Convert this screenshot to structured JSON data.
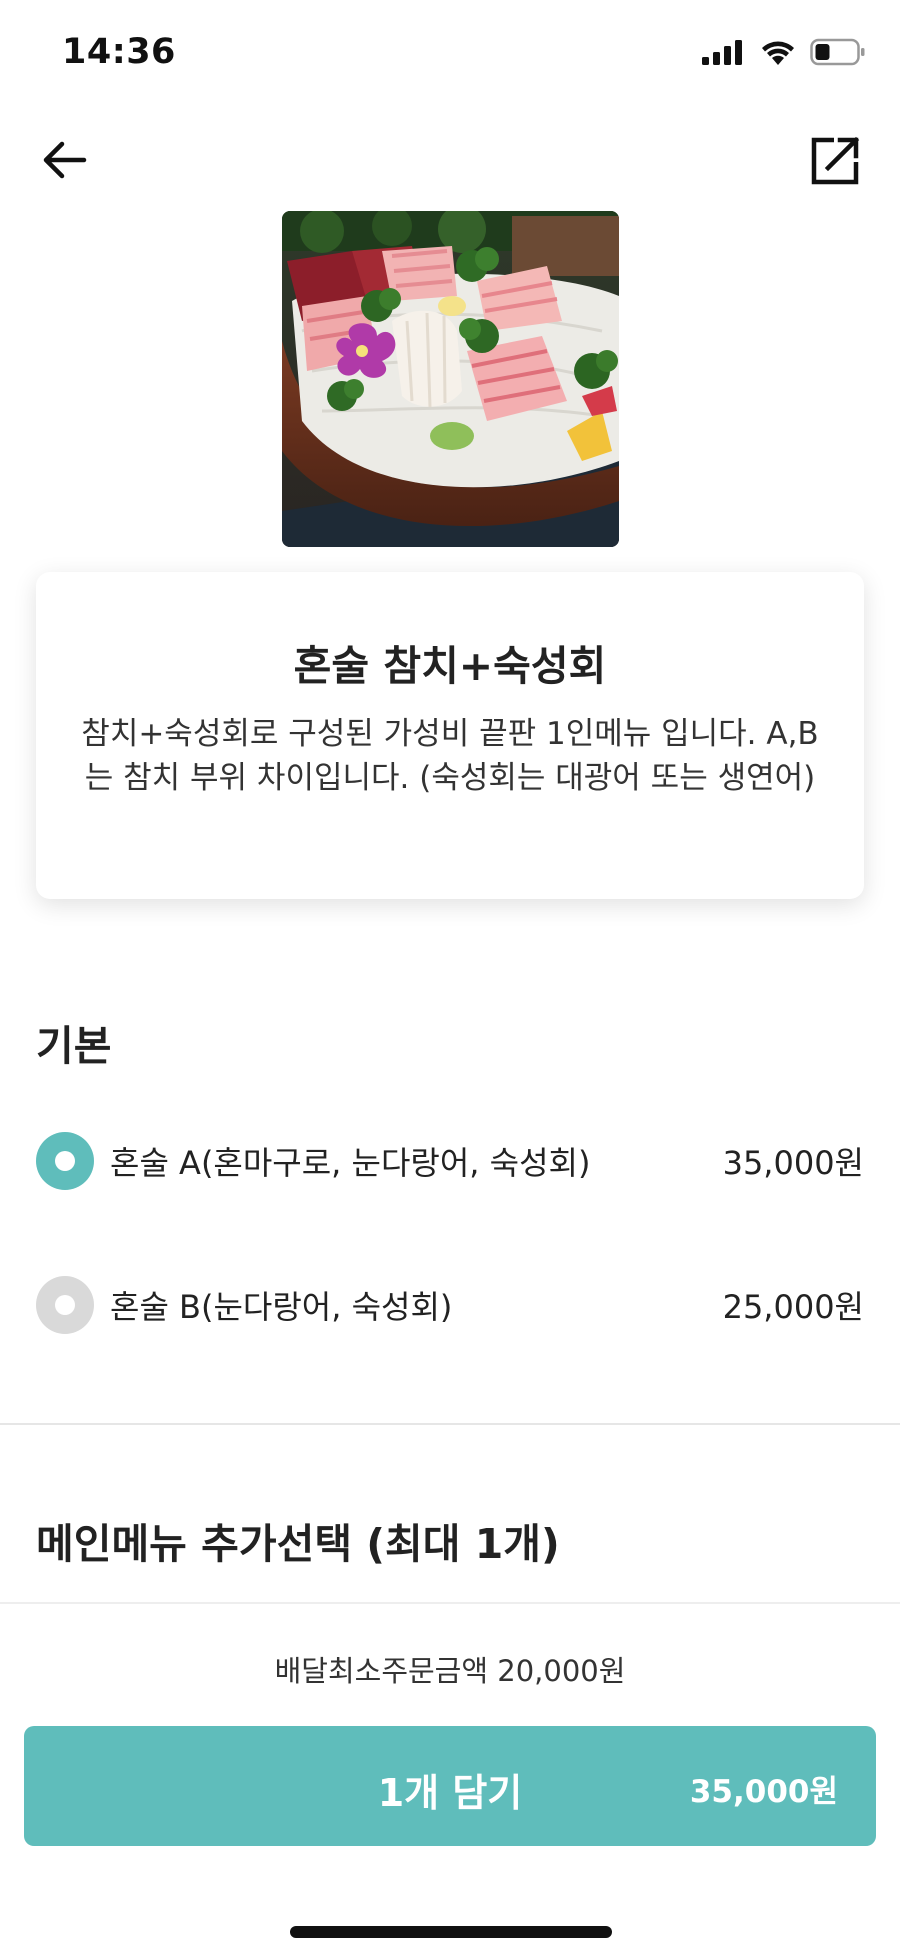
{
  "status_bar": {
    "time": "14:36"
  },
  "icons": {
    "back": "arrow-left-icon",
    "share": "share-icon"
  },
  "product": {
    "name": "혼술 참치+숙성회",
    "description": "참치+숙성회로 구성된 가성비 끝판 1인메뉴 입니다. A,B는 참치 부위 차이입니다. (숙성회는 대광어 또는 생연어)"
  },
  "basic_section": {
    "title": "기본",
    "options": [
      {
        "label": "혼술 A(혼마구로, 눈다랑어, 숙성회)",
        "price": "35,000원",
        "selected": true
      },
      {
        "label": "혼술 B(눈다랑어, 숙성회)",
        "price": "25,000원",
        "selected": false
      }
    ]
  },
  "extra_section": {
    "title": "메인메뉴 추가선택 (최대 1개)"
  },
  "footer": {
    "min_order": "배달최소주문금액 20,000원",
    "cart_button_label": "1개 담기",
    "cart_button_price": "35,000원"
  },
  "colors": {
    "accent": "#5fbdbb",
    "radio_unselected": "#d9d9d9"
  }
}
